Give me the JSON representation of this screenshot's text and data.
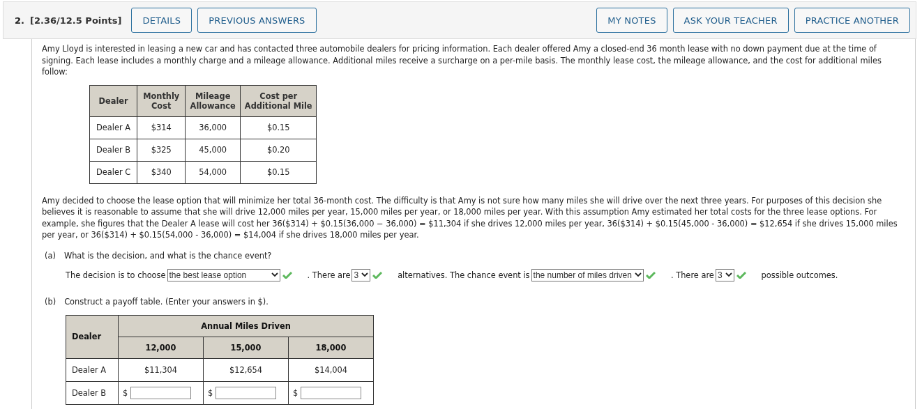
{
  "header": {
    "number": "2.",
    "points": "[2.36/12.5 Points]",
    "left_buttons": [
      "DETAILS",
      "PREVIOUS ANSWERS"
    ],
    "right_buttons": [
      "MY NOTES",
      "ASK YOUR TEACHER",
      "PRACTICE ANOTHER"
    ]
  },
  "intro": "Amy Lloyd is interested in leasing a new car and has contacted three automobile dealers for pricing information. Each dealer offered Amy a closed-end 36 month lease with no down payment due at the time of signing. Each lease includes a monthly charge and a mileage allowance. Additional miles receive a surcharge on a per-mile basis. The monthly lease cost, the mileage allowance, and the cost for additional miles follow:",
  "lease_table": {
    "columns": [
      "Dealer",
      "Monthly Cost",
      "Mileage Allowance",
      "Cost per Additional Mile"
    ],
    "rows": [
      [
        "Dealer A",
        "$314",
        "36,000",
        "$0.15"
      ],
      [
        "Dealer B",
        "$325",
        "45,000",
        "$0.20"
      ],
      [
        "Dealer C",
        "$340",
        "54,000",
        "$0.15"
      ]
    ]
  },
  "paragraph": "Amy decided to choose the lease option that will minimize her total 36-month cost. The difficulty is that Amy is not sure how many miles she will drive over the next three years. For purposes of this decision she believes it is reasonable to assume that she will drive 12,000 miles per year, 15,000 miles per year, or 18,000 miles per year. With this assumption Amy estimated her total costs for the three lease options. For example, she figures that the Dealer A lease will cost her 36($314) + $0.15(36,000 − 36,000) = $11,304 if she drives 12,000 miles per year, 36($314) + $0.15(45,000 - 36,000) = $12,654 if she drives 15,000 miles per year, or 36($314) + $0.15(54,000 - 36,000) = $14,004 if she drives 18,000 miles per year.",
  "part_a": {
    "label": "(a)",
    "question": "What is the decision, and what is the chance event?",
    "segments": [
      {
        "kind": "text",
        "text": "The decision is to choose"
      },
      {
        "kind": "select",
        "value": "the best lease option",
        "correct": true,
        "wide": true
      },
      {
        "kind": "text",
        "text": ". There are"
      },
      {
        "kind": "select",
        "value": "3",
        "correct": true,
        "wide": false
      },
      {
        "kind": "text",
        "text": "alternatives. The chance event is"
      },
      {
        "kind": "select",
        "value": "the number of miles driven",
        "correct": true,
        "wide": false
      },
      {
        "kind": "text",
        "text": ". There are"
      },
      {
        "kind": "select",
        "value": "3",
        "correct": true,
        "wide": false
      },
      {
        "kind": "text",
        "text": "possible outcomes."
      }
    ]
  },
  "part_b": {
    "label": "(b)",
    "question": "Construct a payoff table. (Enter your answers in $).",
    "payoff_table": {
      "row_header": "Dealer",
      "group_header": "Annual Miles Driven",
      "columns": [
        "12,000",
        "15,000",
        "18,000"
      ],
      "rows": [
        {
          "dealer": "Dealer A",
          "cells": [
            {
              "kind": "value",
              "text": "$11,304"
            },
            {
              "kind": "value",
              "text": "$12,654"
            },
            {
              "kind": "value",
              "text": "$14,004"
            }
          ]
        },
        {
          "dealer": "Dealer B",
          "cells": [
            {
              "kind": "input",
              "prefix": "$"
            },
            {
              "kind": "input",
              "prefix": "$"
            },
            {
              "kind": "input",
              "prefix": "$"
            }
          ]
        }
      ]
    }
  }
}
